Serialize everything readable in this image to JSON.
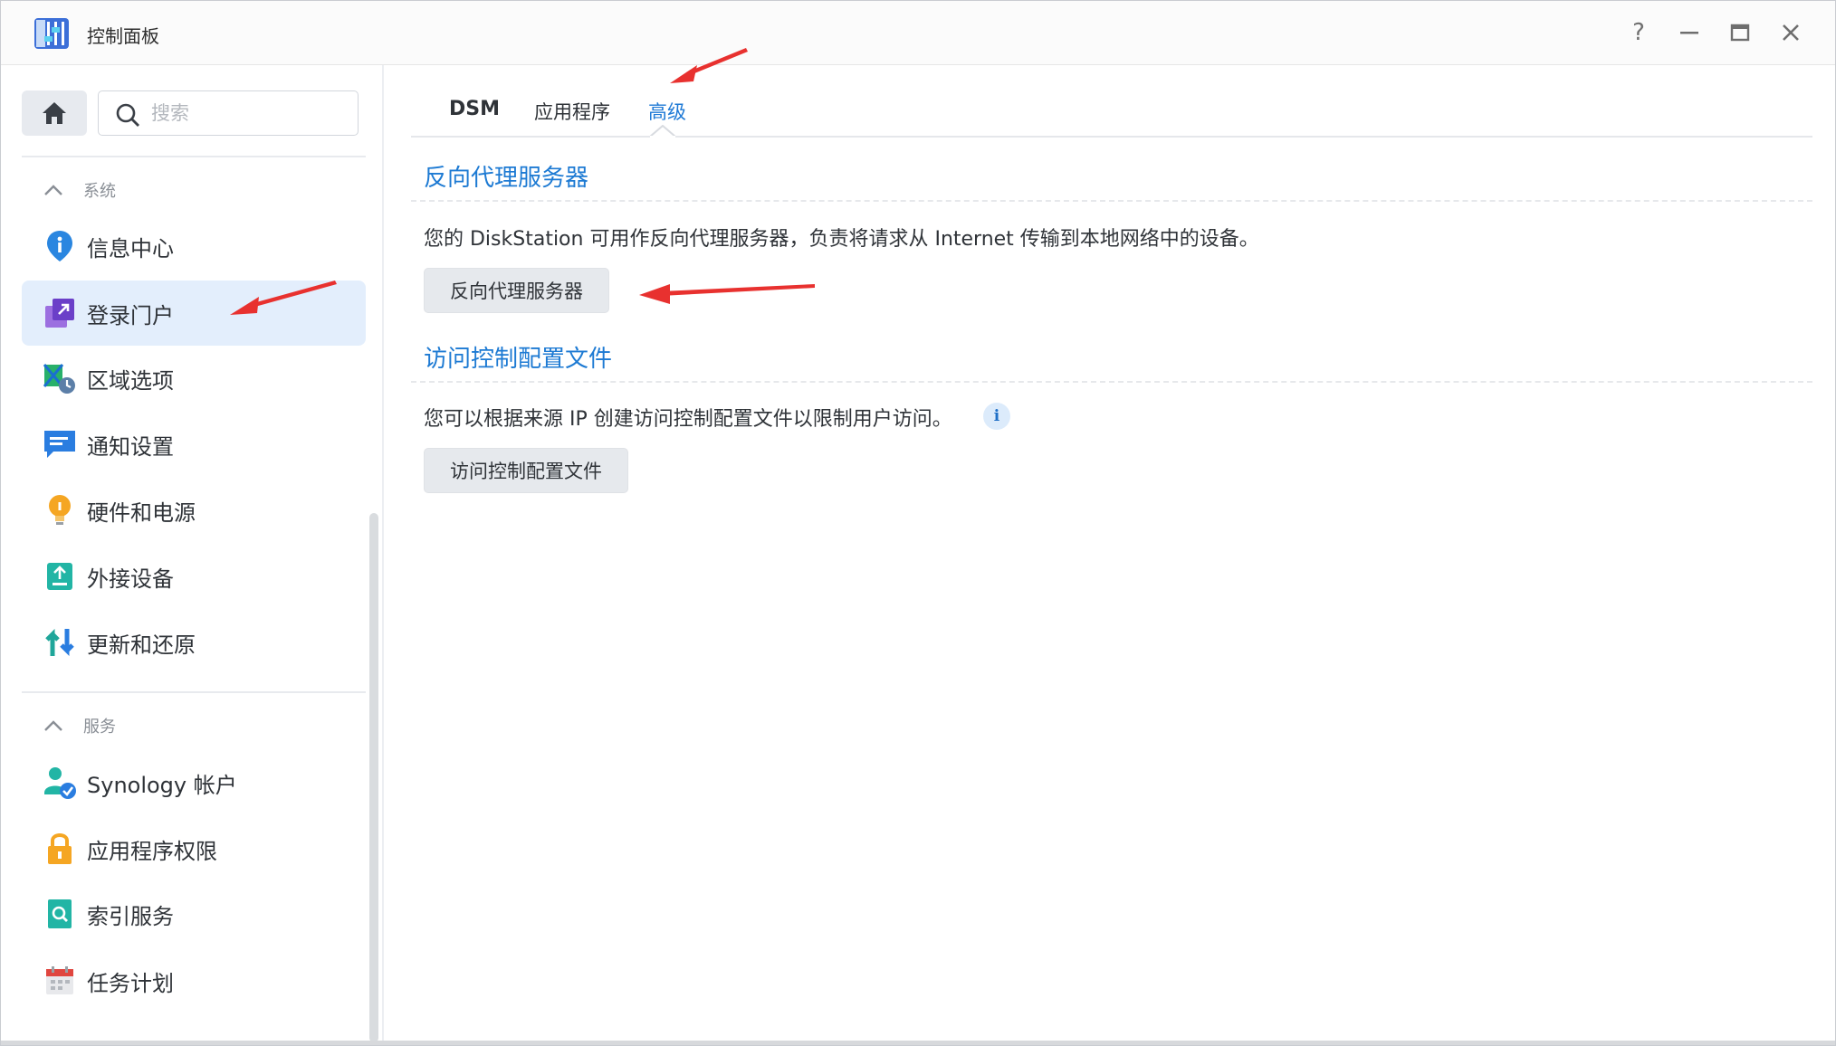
{
  "window": {
    "title": "控制面板",
    "help_label": "?"
  },
  "sidebar": {
    "search_placeholder": "搜索",
    "groups": [
      {
        "label": "系统",
        "items": [
          {
            "label": "信息中心",
            "icon": "info-center-icon"
          },
          {
            "label": "登录门户",
            "icon": "login-portal-icon",
            "active": true
          },
          {
            "label": "区域选项",
            "icon": "regional-options-icon"
          },
          {
            "label": "通知设置",
            "icon": "notification-icon"
          },
          {
            "label": "硬件和电源",
            "icon": "hardware-power-icon"
          },
          {
            "label": "外接设备",
            "icon": "external-devices-icon"
          },
          {
            "label": "更新和还原",
            "icon": "update-restore-icon"
          }
        ]
      },
      {
        "label": "服务",
        "items": [
          {
            "label": "Synology 帐户",
            "icon": "synology-account-icon"
          },
          {
            "label": "应用程序权限",
            "icon": "app-privileges-icon"
          },
          {
            "label": "索引服务",
            "icon": "indexing-service-icon"
          },
          {
            "label": "任务计划",
            "icon": "task-scheduler-icon"
          }
        ]
      }
    ]
  },
  "main": {
    "tabs": [
      {
        "label": "DSM"
      },
      {
        "label": "应用程序"
      },
      {
        "label": "高级",
        "active": true
      }
    ],
    "sections": [
      {
        "title": "反向代理服务器",
        "description": "您的 DiskStation 可用作反向代理服务器，负责将请求从 Internet 传输到本地网络中的设备。",
        "button": "反向代理服务器"
      },
      {
        "title": "访问控制配置文件",
        "description": "您可以根据来源 IP 创建访问控制配置文件以限制用户访问。",
        "button": "访问控制配置文件",
        "info_badge": "i"
      }
    ]
  },
  "colors": {
    "accent": "#1d7ad3",
    "active_item_bg": "#e3eefc",
    "annotation_arrow": "#e8312f"
  }
}
